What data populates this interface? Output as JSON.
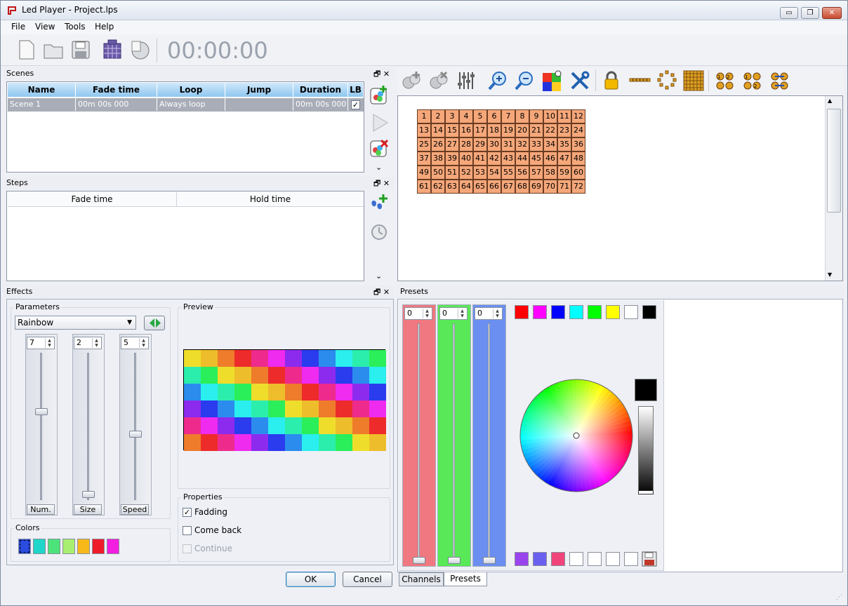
{
  "window": {
    "title": "Led Player - Project.lps",
    "min": "▭",
    "max": "❐",
    "close": "✕"
  },
  "menu": [
    "File",
    "View",
    "Tools",
    "Help"
  ],
  "toolbar": {
    "timer": "00:00:00",
    "icons": [
      "new-file-icon",
      "open-folder-icon",
      "save-icon",
      "matrix-icon",
      "timer-icon"
    ]
  },
  "scenes": {
    "title": "Scenes",
    "columns": [
      "Name",
      "Fade time",
      "Loop",
      "Jump",
      "Duration",
      "LB"
    ],
    "rows": [
      {
        "name": "Scene 1",
        "fade": "00m 00s 000",
        "loop": "Always loop",
        "jump": "",
        "duration": "00m 00s 000",
        "lb": "✓"
      }
    ],
    "more": "⌄"
  },
  "steps": {
    "title": "Steps",
    "columns": [
      "Fade time",
      "Hold time"
    ],
    "more": "⌄"
  },
  "matrix": {
    "rows": 6,
    "cols": 12,
    "cell_color": "#f5a77a"
  },
  "effects": {
    "title": "Effects",
    "parameters_label": "Parameters",
    "effect_value": "Rainbow",
    "sliders": [
      {
        "label": "Num.",
        "value": "7",
        "level": 0.6
      },
      {
        "label": "Size",
        "value": "2",
        "level": 0.04
      },
      {
        "label": "Speed",
        "value": "5",
        "level": 0.45
      }
    ],
    "preview_label": "Preview",
    "properties_label": "Properties",
    "properties": [
      {
        "label": "Fadding",
        "checked": true,
        "enabled": true
      },
      {
        "label": "Come back",
        "checked": false,
        "enabled": true
      },
      {
        "label": "Continue",
        "checked": false,
        "enabled": false
      }
    ],
    "colors_label": "Colors",
    "colors": [
      "#2a4ce0",
      "#1ed6c9",
      "#4be37a",
      "#a8ee70",
      "#f7b81a",
      "#ee1c2b",
      "#f31ee0"
    ]
  },
  "presets": {
    "title": "Presets",
    "rgb": [
      {
        "value": "0",
        "color": "#f07880"
      },
      {
        "value": "0",
        "color": "#58e858"
      },
      {
        "value": "0",
        "color": "#6a8ff0"
      }
    ],
    "palette_top": [
      "#ff0000",
      "#ff00ff",
      "#0000ff",
      "#00ffff",
      "#00ff00",
      "#ffff00",
      "#ffffff",
      "#000000"
    ],
    "palette_bottom": [
      "#9a44ee",
      "#6a60f0",
      "#f0447a",
      "#ffffff",
      "#ffffff",
      "#ffffff",
      "#ffffff"
    ],
    "current_color": "#000000"
  },
  "dialog": {
    "ok": "OK",
    "cancel": "Cancel"
  },
  "tabs": [
    "Channels",
    "Presets"
  ]
}
